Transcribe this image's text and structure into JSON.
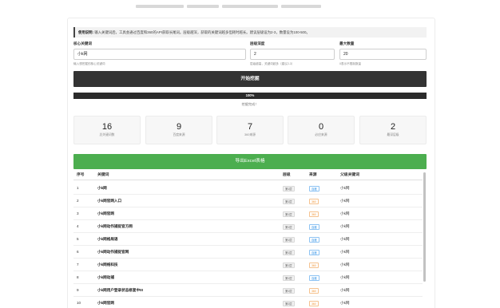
{
  "notice": {
    "label": "使用说明:",
    "text": "输入关键词后，工具会通过百度和360的API获取长尾词。层级越深，获取的关键词越多但耗时越长。建议层级设为2-3，数量设为100-500。"
  },
  "form": {
    "keyword": {
      "label": "核心关键词",
      "value": "小k网",
      "hint": "输入想挖掘的核心关键词"
    },
    "depth": {
      "label": "层级深度",
      "value": "2",
      "hint": "层级越高，关键词越多（建议2-3）"
    },
    "count": {
      "label": "最大数量",
      "value": "20",
      "hint": "0表示不限制数量"
    }
  },
  "start_button": "开始挖掘",
  "progress": {
    "percent": 100,
    "label": "100%",
    "status": "挖掘完成！"
  },
  "stats": [
    {
      "value": "16",
      "label": "总关键词数"
    },
    {
      "value": "9",
      "label": "百度来源"
    },
    {
      "value": "7",
      "label": "360来源"
    },
    {
      "value": "0",
      "label": "必应来源"
    },
    {
      "value": "2",
      "label": "最深层级"
    }
  ],
  "export_button": "导出Excel表格",
  "table": {
    "headers": {
      "index": "序号",
      "keyword": "关键词",
      "level": "层级",
      "source": "来源",
      "parent": "父级关键词"
    },
    "rows": [
      {
        "index": "1",
        "keyword": "小k网",
        "level": "第1层",
        "source": "百度",
        "parent": "小k网"
      },
      {
        "index": "2",
        "keyword": "小k网官网入口",
        "level": "第1层",
        "source": "360",
        "parent": "小k网"
      },
      {
        "index": "3",
        "keyword": "小k网官网",
        "level": "第1层",
        "source": "360",
        "parent": "小k网"
      },
      {
        "index": "4",
        "keyword": "小k网动作捕捉官方网",
        "level": "第1层",
        "source": "百度",
        "parent": "小k网"
      },
      {
        "index": "5",
        "keyword": "小k网格局语",
        "level": "第1层",
        "source": "百度",
        "parent": "小k网"
      },
      {
        "index": "6",
        "keyword": "小k网动作捕捉官网",
        "level": "第1层",
        "source": "百度",
        "parent": "小k网"
      },
      {
        "index": "7",
        "keyword": "小k网络科技",
        "level": "第1层",
        "source": "360",
        "parent": "小k网"
      },
      {
        "index": "8",
        "keyword": "小k网动捕",
        "level": "第1层",
        "source": "百度",
        "parent": "小k网"
      },
      {
        "index": "9",
        "keyword": "小k网用户登录状态修复中III",
        "level": "第1层",
        "source": "360",
        "parent": "小k网"
      },
      {
        "index": "10",
        "keyword": "小k网官网",
        "level": "第2层",
        "source": "360",
        "parent": "小k网"
      }
    ]
  }
}
